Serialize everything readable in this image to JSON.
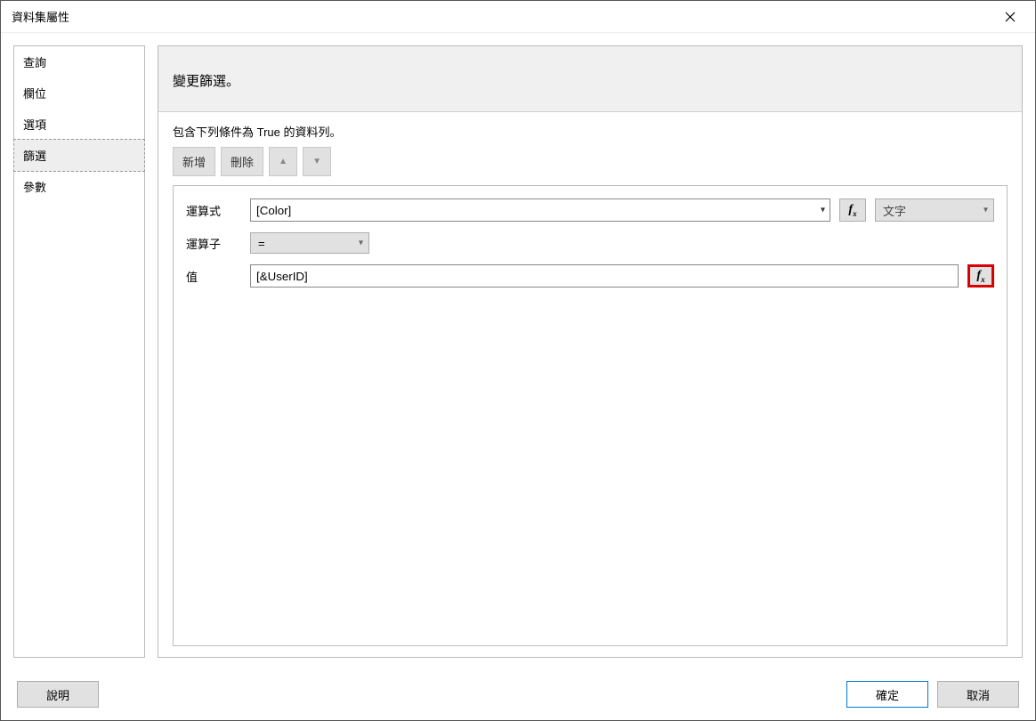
{
  "window": {
    "title": "資料集屬性"
  },
  "sidebar": {
    "items": [
      {
        "label": "查詢",
        "selected": false
      },
      {
        "label": "欄位",
        "selected": false
      },
      {
        "label": "選項",
        "selected": false
      },
      {
        "label": "篩選",
        "selected": true
      },
      {
        "label": "參數",
        "selected": false
      }
    ]
  },
  "content": {
    "header": "變更篩選。",
    "instruction": "包含下列條件為 True 的資料列。",
    "toolbar": {
      "add": "新增",
      "delete": "刪除",
      "move_up_icon": "▲",
      "move_down_icon": "▼"
    },
    "filter": {
      "expression_label": "運算式",
      "expression_value": "[Color]",
      "fx_label": "fx",
      "type_value": "文字",
      "operator_label": "運算子",
      "operator_value": "=",
      "value_label": "值",
      "value_value": "[&UserID]"
    }
  },
  "footer": {
    "help": "說明",
    "ok": "確定",
    "cancel": "取消"
  }
}
